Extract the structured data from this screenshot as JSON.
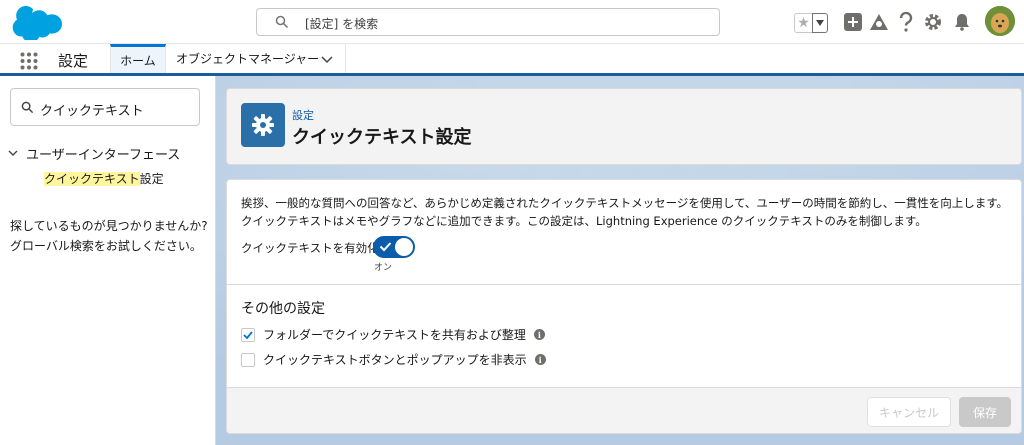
{
  "global_header": {
    "search_placeholder": "[設定] を検索",
    "icons": [
      "salesforce-logo",
      "search-icon",
      "favorites-star-icon",
      "chevron-down-icon",
      "add-icon",
      "trailhead-icon",
      "help-icon",
      "gear-icon",
      "bell-icon",
      "avatar"
    ]
  },
  "context_bar": {
    "app_name": "設定",
    "tabs": [
      {
        "label": "ホーム",
        "active": true
      },
      {
        "label": "オブジェクトマネージャー",
        "active": false
      }
    ]
  },
  "sidebar": {
    "quickfind_value": "クイックテキスト",
    "tree_parent": "ユーザーインターフェース",
    "tree_child_highlight": "クイックテキスト",
    "tree_child_rest": "設定",
    "not_found_line1": "探しているものが見つかりませんか?",
    "not_found_line2": "グローバル検索をお試しください。"
  },
  "page_header": {
    "eyebrow": "設定",
    "title": "クイックテキスト設定"
  },
  "main": {
    "description": "挨拶、一般的な質問への回答など、あらかじめ定義されたクイックテキストメッセージを使用して、ユーザーの時間を節約し、一貫性を向上します。クイックテキストはメモやグラフなどに追加できます。この設定は、Lightning Experience のクイックテキストのみを制御します。",
    "toggle_label": "クイックテキストを有効化",
    "toggle_state": "オン",
    "toggle_on": true,
    "section_title": "その他の設定",
    "checkboxes": [
      {
        "label": "フォルダーでクイックテキストを共有および整理",
        "checked": true
      },
      {
        "label": "クイックテキストボタンとポップアップを非表示",
        "checked": false
      }
    ]
  },
  "footer": {
    "cancel_label": "キャンセル",
    "save_label": "保存"
  },
  "colors": {
    "brand_blue": "#0176d3",
    "toggle_blue": "#0b5cab",
    "gear_tile": "#2b6fa8",
    "highlight": "#fff59c"
  }
}
